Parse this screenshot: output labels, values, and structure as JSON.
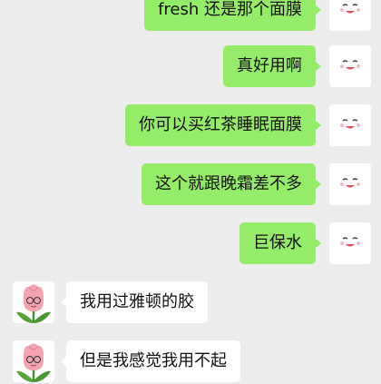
{
  "colors": {
    "background": "#ededed",
    "self_bubble": "#95ec69",
    "other_bubble": "#ffffff",
    "text": "#111111"
  },
  "messages": [
    {
      "sender": "self",
      "text": "fresh 还是那个面膜",
      "avatar_icon": "cute-face-avatar-icon"
    },
    {
      "sender": "self",
      "text": "真好用啊",
      "avatar_icon": "cute-face-avatar-icon"
    },
    {
      "sender": "self",
      "text": "你可以买红茶睡眠面膜",
      "avatar_icon": "cute-face-avatar-icon"
    },
    {
      "sender": "self",
      "text": "这个就跟晚霜差不多",
      "avatar_icon": "cute-face-avatar-icon"
    },
    {
      "sender": "self",
      "text": "巨保水",
      "avatar_icon": "cute-face-avatar-icon"
    },
    {
      "sender": "other",
      "text": "我用过雅顿的胶",
      "avatar_icon": "tulip-avatar-icon"
    },
    {
      "sender": "other",
      "text": "但是我感觉我用不起",
      "avatar_icon": "tulip-avatar-icon"
    }
  ]
}
